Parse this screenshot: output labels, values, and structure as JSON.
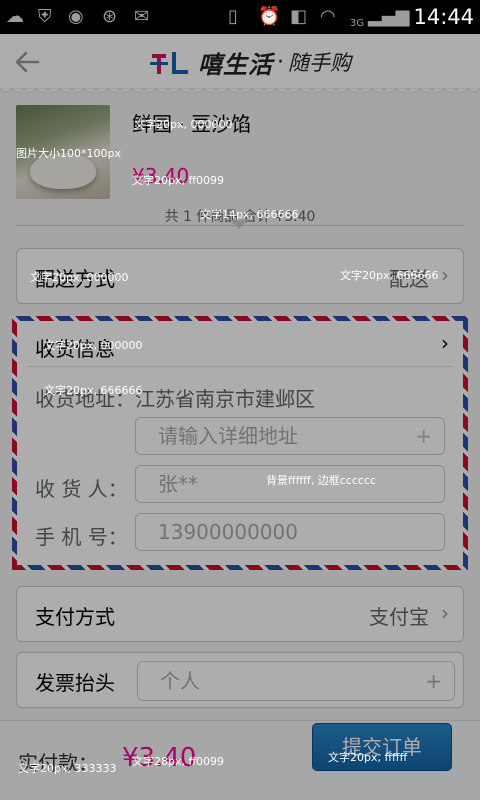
{
  "status_bar": {
    "time": "14:44",
    "network": "3G"
  },
  "header": {
    "logo_mark": "TL",
    "logo_text": "嘻生活",
    "logo_dot": "·",
    "logo_sub": "随手购"
  },
  "product": {
    "name": "鲜园 · 豆沙馅",
    "price": "¥3.40",
    "total_text": "共 1 件商品 合计 ¥3.40"
  },
  "delivery": {
    "label": "配送方式",
    "value": "配送"
  },
  "address": {
    "title": "收货信息",
    "area_label": "收货地址：",
    "area_value": "江苏省南京市建邺区",
    "detail_placeholder": "请输入详细地址",
    "receiver_label": "收 货 人：",
    "receiver_value": "张**",
    "phone_label": "手 机 号：",
    "phone_value": "13900000000"
  },
  "payment": {
    "label": "支付方式",
    "value": "支付宝"
  },
  "invoice": {
    "label": "发票抬头",
    "placeholder": "个人"
  },
  "footer": {
    "total_label": "实付款：",
    "total_value": "¥3.40",
    "submit_label": "提交订单"
  },
  "annotations": {
    "image_size": "图片大小100*100px",
    "name_text": "文字20px, 000000",
    "price_text": "文字20px, ff0099",
    "total_text": "文字14px, 666666",
    "delivery_label_text": "文字20px, 000000",
    "delivery_value_text": "文字20px, 666666",
    "address_title_text": "文字20px, 000000",
    "address_label_text": "文字20px, 666666",
    "input_style": "背景ffffff, 边框cccccc",
    "footer_label_text": "文字20px, 333333",
    "footer_value_text": "文字28px, ff0099",
    "submit_text": "文字20px, ffffff"
  },
  "colors": {
    "accent_pink": "#ff0099",
    "button_blue": "#1a72b8",
    "border": "#cccccc"
  }
}
